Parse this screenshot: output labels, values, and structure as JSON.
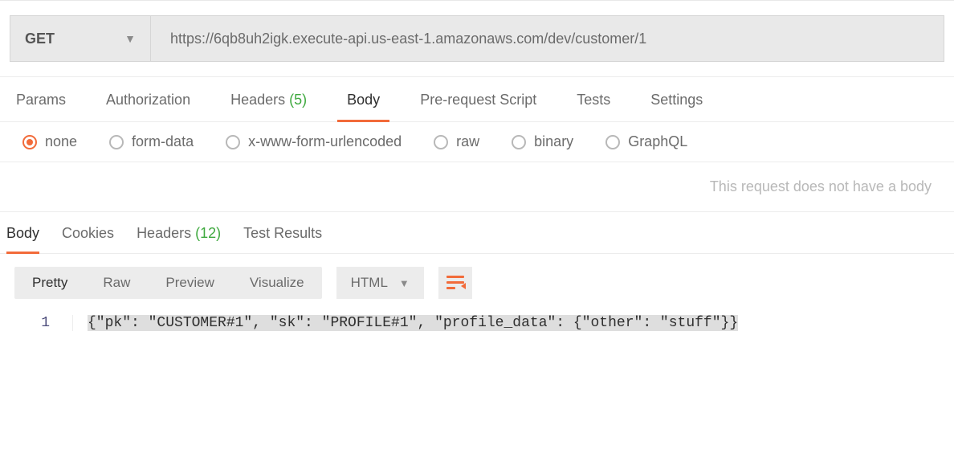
{
  "request": {
    "method": "GET",
    "url": "https://6qb8uh2igk.execute-api.us-east-1.amazonaws.com/dev/customer/1",
    "tabs": {
      "params": "Params",
      "authorization": "Authorization",
      "headers_label": "Headers",
      "headers_count": "(5)",
      "body": "Body",
      "prerequest": "Pre-request Script",
      "tests": "Tests",
      "settings": "Settings"
    },
    "body_types": {
      "none": "none",
      "form_data": "form-data",
      "urlencoded": "x-www-form-urlencoded",
      "raw": "raw",
      "binary": "binary",
      "graphql": "GraphQL"
    },
    "no_body_text": "This request does not have a body"
  },
  "response": {
    "tabs": {
      "body": "Body",
      "cookies": "Cookies",
      "headers_label": "Headers",
      "headers_count": "(12)",
      "test_results": "Test Results"
    },
    "viewer": {
      "pretty": "Pretty",
      "raw": "Raw",
      "preview": "Preview",
      "visualize": "Visualize",
      "format": "HTML"
    },
    "line_number": "1",
    "body_text": "{\"pk\": \"CUSTOMER#1\", \"sk\": \"PROFILE#1\", \"profile_data\": {\"other\": \"stuff\"}}"
  }
}
